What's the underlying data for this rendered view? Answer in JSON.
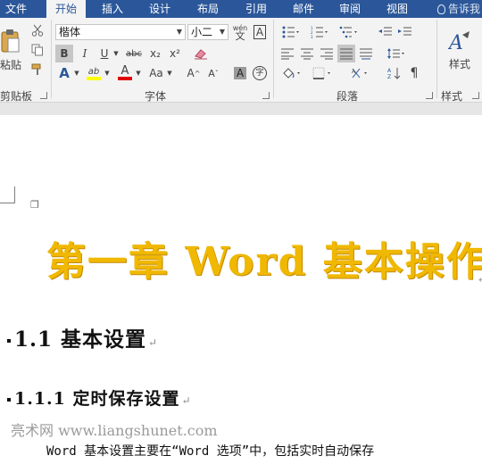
{
  "tabs": [
    "文件",
    "开始",
    "插入",
    "设计",
    "布局",
    "引用",
    "邮件",
    "审阅",
    "视图"
  ],
  "active_tab": "开始",
  "tell_me": "告诉我",
  "clipboard": {
    "paste_label": "粘贴",
    "group_label": "剪贴板"
  },
  "font": {
    "name": "楷体",
    "size": "小二",
    "group_label": "字体",
    "wen_label": "wén",
    "wen_char": "文",
    "boxed_a": "A",
    "bold": "B",
    "italic": "I",
    "underline": "U",
    "strikethrough": "abc",
    "subscript": "x₂",
    "superscript": "x²",
    "text_effects": "A",
    "highlight": "ab",
    "font_color": "A",
    "case": "Aa",
    "grow": "A",
    "shrink": "A",
    "char_shading": "A",
    "enclose": "字"
  },
  "paragraph": {
    "group_label": "段落"
  },
  "styles": {
    "label": "样式",
    "group_label": "样式"
  },
  "document": {
    "heading1": "第一章 Word 基本操作",
    "heading2": "1.1  基本设置",
    "heading3": "1.1.1  定时保存设置",
    "return_mark": "↵",
    "watermark": "亮术网 www.liangshunet.com",
    "body": "Word 基本设置主要在“Word 选项”中，包括实时自动保存"
  },
  "colors": {
    "accent": "#2b579a",
    "heading1": "#f0b800",
    "font_color_bar": "#e00000",
    "highlight_bar": "#ffff00"
  }
}
